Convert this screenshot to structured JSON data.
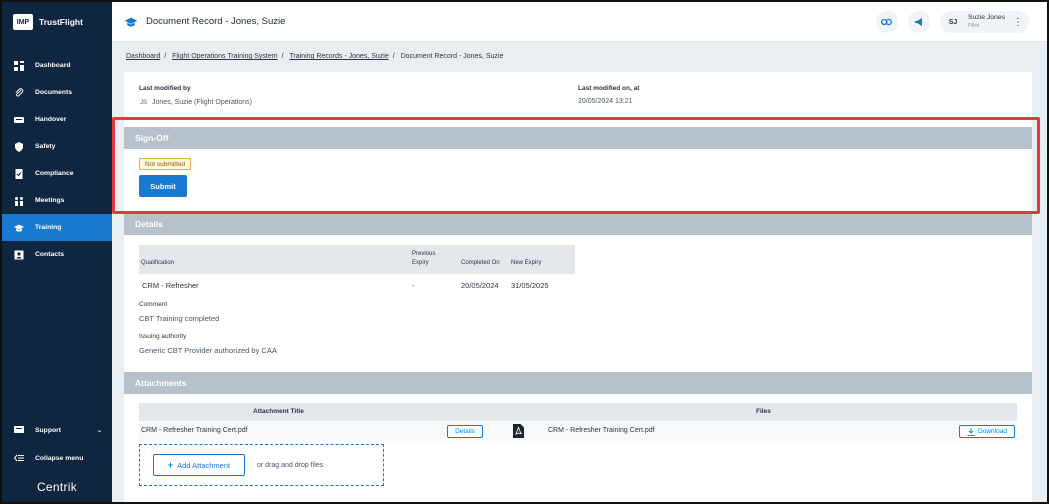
{
  "brand": {
    "logo": "IMP",
    "name": "TrustFlight"
  },
  "sidebar": {
    "items": [
      {
        "label": "Dashboard",
        "icon": "dashboard-icon"
      },
      {
        "label": "Documents",
        "icon": "paperclip-icon"
      },
      {
        "label": "Handover",
        "icon": "handover-icon"
      },
      {
        "label": "Safety",
        "icon": "shield-icon"
      },
      {
        "label": "Compliance",
        "icon": "compliance-icon"
      },
      {
        "label": "Meetings",
        "icon": "meetings-icon"
      },
      {
        "label": "Training",
        "icon": "graduation-cap-icon",
        "active": true
      },
      {
        "label": "Contacts",
        "icon": "contacts-icon"
      }
    ],
    "support": "Support",
    "collapse": "Collapse menu",
    "footer_logo": "Centrik"
  },
  "header": {
    "title": "Document Record - Jones, Suzie",
    "user": {
      "initials": "SJ",
      "name": "Suzie Jones",
      "role": "Pilot"
    }
  },
  "breadcrumb": {
    "items": [
      "Dashboard",
      "Flight Operations Training System",
      "Training Records - Jones, Suzie"
    ],
    "current": "Document Record - Jones, Suzie"
  },
  "meta": {
    "modified_by_label": "Last modified by",
    "modified_by_initials": "JS",
    "modified_by": "Jones, Suzie (Flight Operations)",
    "modified_on_label": "Last modified on, at",
    "modified_on": "20/05/2024 13:21"
  },
  "signoff": {
    "title": "Sign-Off",
    "status": "Not submitted",
    "submit_label": "Submit"
  },
  "details": {
    "title": "Details",
    "columns": [
      "Qualification",
      "Previous",
      "Expiry",
      "Completed On",
      "New Expiry"
    ],
    "row": {
      "qualification": "CRM - Refresher",
      "previous_expiry": "-",
      "completed_on": "20/05/2024",
      "new_expiry": "31/05/2025"
    },
    "comment_label": "Comment",
    "comment": "CBT Training completed",
    "authority_label": "Issuing authority",
    "authority": "Generic CBT Provider authorized by CAA"
  },
  "attachments": {
    "title": "Attachments",
    "col_title": "Attachment Title",
    "col_files": "Files",
    "row": {
      "title": "CRM - Refresher Training Cert.pdf",
      "details": "Details",
      "file": "CRM - Refresher Training Cert.pdf",
      "download": "Download"
    },
    "add_label": "Add Attachment",
    "drop_text": "or drag and drop files"
  },
  "colors": {
    "accent": "#1978d0",
    "sidebar": "#0f2640",
    "highlight": "#e3393c",
    "section_header": "#b7c1cc"
  }
}
